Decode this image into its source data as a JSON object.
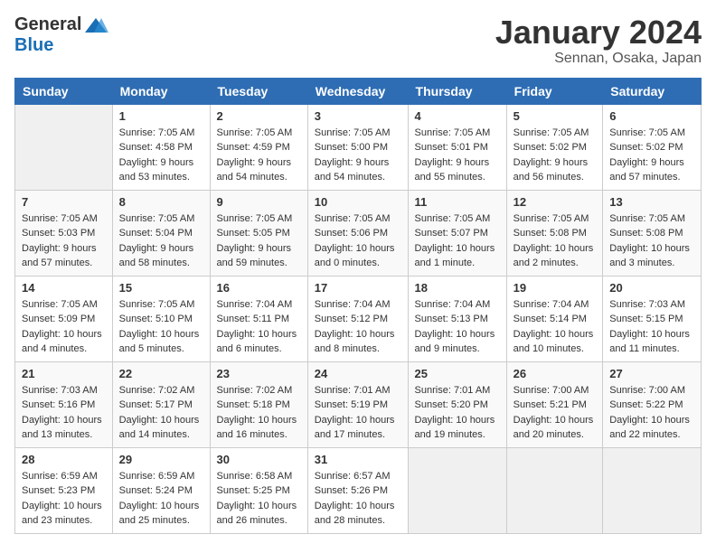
{
  "header": {
    "logo_general": "General",
    "logo_blue": "Blue",
    "month_title": "January 2024",
    "location": "Sennan, Osaka, Japan"
  },
  "weekdays": [
    "Sunday",
    "Monday",
    "Tuesday",
    "Wednesday",
    "Thursday",
    "Friday",
    "Saturday"
  ],
  "weeks": [
    [
      {
        "day": "",
        "sunrise": "",
        "sunset": "",
        "daylight": ""
      },
      {
        "day": "1",
        "sunrise": "Sunrise: 7:05 AM",
        "sunset": "Sunset: 4:58 PM",
        "daylight": "Daylight: 9 hours and 53 minutes."
      },
      {
        "day": "2",
        "sunrise": "Sunrise: 7:05 AM",
        "sunset": "Sunset: 4:59 PM",
        "daylight": "Daylight: 9 hours and 54 minutes."
      },
      {
        "day": "3",
        "sunrise": "Sunrise: 7:05 AM",
        "sunset": "Sunset: 5:00 PM",
        "daylight": "Daylight: 9 hours and 54 minutes."
      },
      {
        "day": "4",
        "sunrise": "Sunrise: 7:05 AM",
        "sunset": "Sunset: 5:01 PM",
        "daylight": "Daylight: 9 hours and 55 minutes."
      },
      {
        "day": "5",
        "sunrise": "Sunrise: 7:05 AM",
        "sunset": "Sunset: 5:02 PM",
        "daylight": "Daylight: 9 hours and 56 minutes."
      },
      {
        "day": "6",
        "sunrise": "Sunrise: 7:05 AM",
        "sunset": "Sunset: 5:02 PM",
        "daylight": "Daylight: 9 hours and 57 minutes."
      }
    ],
    [
      {
        "day": "7",
        "sunrise": "Sunrise: 7:05 AM",
        "sunset": "Sunset: 5:03 PM",
        "daylight": "Daylight: 9 hours and 57 minutes."
      },
      {
        "day": "8",
        "sunrise": "Sunrise: 7:05 AM",
        "sunset": "Sunset: 5:04 PM",
        "daylight": "Daylight: 9 hours and 58 minutes."
      },
      {
        "day": "9",
        "sunrise": "Sunrise: 7:05 AM",
        "sunset": "Sunset: 5:05 PM",
        "daylight": "Daylight: 9 hours and 59 minutes."
      },
      {
        "day": "10",
        "sunrise": "Sunrise: 7:05 AM",
        "sunset": "Sunset: 5:06 PM",
        "daylight": "Daylight: 10 hours and 0 minutes."
      },
      {
        "day": "11",
        "sunrise": "Sunrise: 7:05 AM",
        "sunset": "Sunset: 5:07 PM",
        "daylight": "Daylight: 10 hours and 1 minute."
      },
      {
        "day": "12",
        "sunrise": "Sunrise: 7:05 AM",
        "sunset": "Sunset: 5:08 PM",
        "daylight": "Daylight: 10 hours and 2 minutes."
      },
      {
        "day": "13",
        "sunrise": "Sunrise: 7:05 AM",
        "sunset": "Sunset: 5:08 PM",
        "daylight": "Daylight: 10 hours and 3 minutes."
      }
    ],
    [
      {
        "day": "14",
        "sunrise": "Sunrise: 7:05 AM",
        "sunset": "Sunset: 5:09 PM",
        "daylight": "Daylight: 10 hours and 4 minutes."
      },
      {
        "day": "15",
        "sunrise": "Sunrise: 7:05 AM",
        "sunset": "Sunset: 5:10 PM",
        "daylight": "Daylight: 10 hours and 5 minutes."
      },
      {
        "day": "16",
        "sunrise": "Sunrise: 7:04 AM",
        "sunset": "Sunset: 5:11 PM",
        "daylight": "Daylight: 10 hours and 6 minutes."
      },
      {
        "day": "17",
        "sunrise": "Sunrise: 7:04 AM",
        "sunset": "Sunset: 5:12 PM",
        "daylight": "Daylight: 10 hours and 8 minutes."
      },
      {
        "day": "18",
        "sunrise": "Sunrise: 7:04 AM",
        "sunset": "Sunset: 5:13 PM",
        "daylight": "Daylight: 10 hours and 9 minutes."
      },
      {
        "day": "19",
        "sunrise": "Sunrise: 7:04 AM",
        "sunset": "Sunset: 5:14 PM",
        "daylight": "Daylight: 10 hours and 10 minutes."
      },
      {
        "day": "20",
        "sunrise": "Sunrise: 7:03 AM",
        "sunset": "Sunset: 5:15 PM",
        "daylight": "Daylight: 10 hours and 11 minutes."
      }
    ],
    [
      {
        "day": "21",
        "sunrise": "Sunrise: 7:03 AM",
        "sunset": "Sunset: 5:16 PM",
        "daylight": "Daylight: 10 hours and 13 minutes."
      },
      {
        "day": "22",
        "sunrise": "Sunrise: 7:02 AM",
        "sunset": "Sunset: 5:17 PM",
        "daylight": "Daylight: 10 hours and 14 minutes."
      },
      {
        "day": "23",
        "sunrise": "Sunrise: 7:02 AM",
        "sunset": "Sunset: 5:18 PM",
        "daylight": "Daylight: 10 hours and 16 minutes."
      },
      {
        "day": "24",
        "sunrise": "Sunrise: 7:01 AM",
        "sunset": "Sunset: 5:19 PM",
        "daylight": "Daylight: 10 hours and 17 minutes."
      },
      {
        "day": "25",
        "sunrise": "Sunrise: 7:01 AM",
        "sunset": "Sunset: 5:20 PM",
        "daylight": "Daylight: 10 hours and 19 minutes."
      },
      {
        "day": "26",
        "sunrise": "Sunrise: 7:00 AM",
        "sunset": "Sunset: 5:21 PM",
        "daylight": "Daylight: 10 hours and 20 minutes."
      },
      {
        "day": "27",
        "sunrise": "Sunrise: 7:00 AM",
        "sunset": "Sunset: 5:22 PM",
        "daylight": "Daylight: 10 hours and 22 minutes."
      }
    ],
    [
      {
        "day": "28",
        "sunrise": "Sunrise: 6:59 AM",
        "sunset": "Sunset: 5:23 PM",
        "daylight": "Daylight: 10 hours and 23 minutes."
      },
      {
        "day": "29",
        "sunrise": "Sunrise: 6:59 AM",
        "sunset": "Sunset: 5:24 PM",
        "daylight": "Daylight: 10 hours and 25 minutes."
      },
      {
        "day": "30",
        "sunrise": "Sunrise: 6:58 AM",
        "sunset": "Sunset: 5:25 PM",
        "daylight": "Daylight: 10 hours and 26 minutes."
      },
      {
        "day": "31",
        "sunrise": "Sunrise: 6:57 AM",
        "sunset": "Sunset: 5:26 PM",
        "daylight": "Daylight: 10 hours and 28 minutes."
      },
      {
        "day": "",
        "sunrise": "",
        "sunset": "",
        "daylight": ""
      },
      {
        "day": "",
        "sunrise": "",
        "sunset": "",
        "daylight": ""
      },
      {
        "day": "",
        "sunrise": "",
        "sunset": "",
        "daylight": ""
      }
    ]
  ]
}
